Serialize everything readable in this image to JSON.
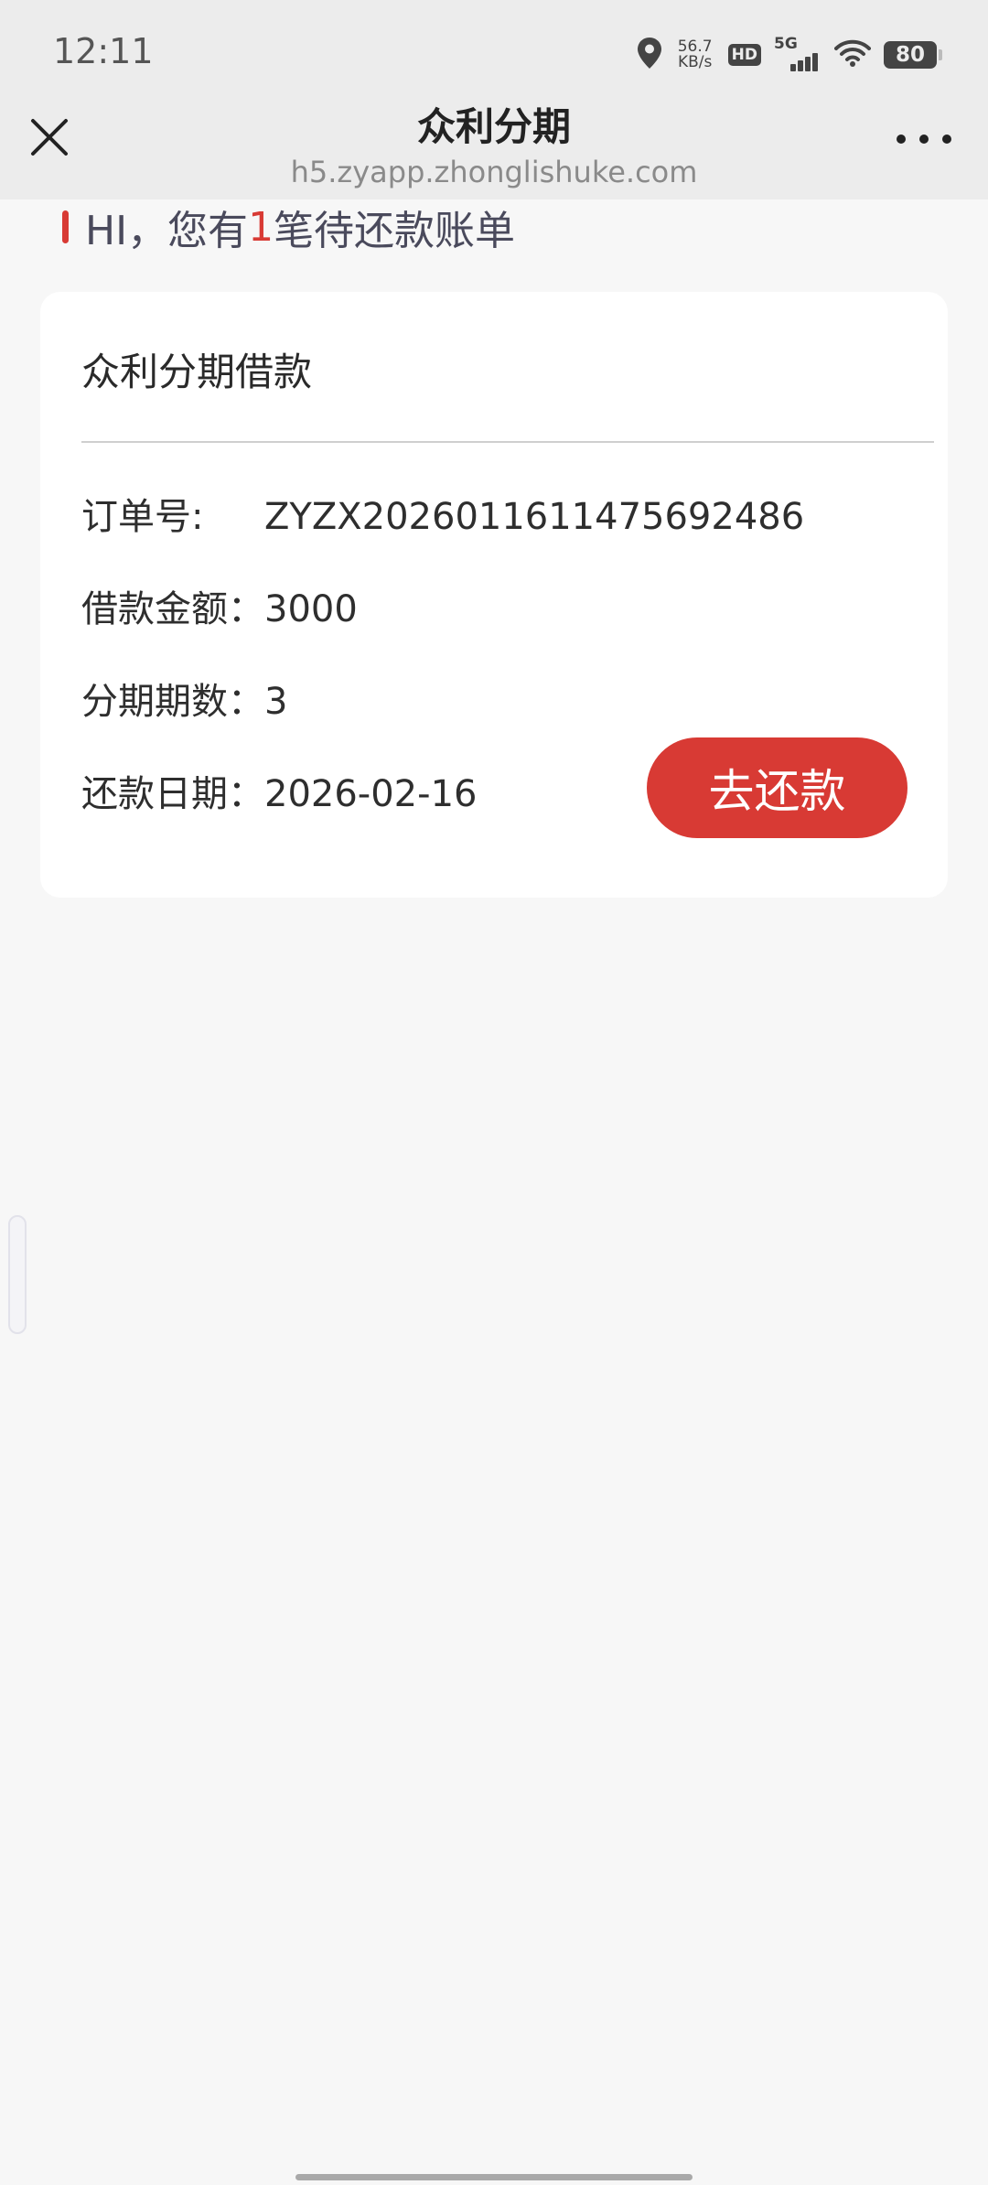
{
  "status_bar": {
    "time": "12:11",
    "net_speed_value": "56.7",
    "net_speed_unit": "KB/s",
    "hd_label": "HD",
    "network_label": "5G",
    "battery_level": "80",
    "icons": [
      "location-icon",
      "wifi-icon",
      "battery-icon"
    ]
  },
  "nav": {
    "title": "众利分期",
    "url": "h5.zyapp.zhonglishuke.com",
    "close_icon": "close-icon",
    "more_icon": "more-icon"
  },
  "greeting": {
    "prefix": "HI，您有",
    "count": "1",
    "suffix": "笔待还款账单"
  },
  "loan_card": {
    "title": "众利分期借款",
    "order_no_label": "订单号:",
    "order_no": "ZYZX2026011611475692486",
    "amount_label": "借款金额：",
    "amount": "3000",
    "installments_label": "分期期数：",
    "installments": "3",
    "due_date_label": "还款日期：",
    "due_date": "2026-02-16",
    "repay_button_label": "去还款"
  },
  "colors": {
    "accent": "#d83a34",
    "header_bg": "#ececec",
    "page_bg": "#f7f7f7",
    "card_bg": "#ffffff"
  }
}
